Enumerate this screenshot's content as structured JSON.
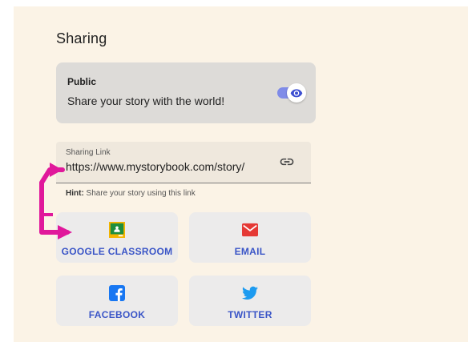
{
  "section": {
    "title": "Sharing"
  },
  "public": {
    "label": "Public",
    "description": "Share your story with the world!",
    "toggle_on": true
  },
  "sharing_link": {
    "label": "Sharing Link",
    "value": "https://www.mystorybook.com/story/",
    "hint_prefix": "Hint:",
    "hint_text": " Share your story using this link"
  },
  "share_buttons": [
    {
      "label": "GOOGLE CLASSROOM",
      "icon": "google-classroom-icon"
    },
    {
      "label": "EMAIL",
      "icon": "email-icon"
    },
    {
      "label": "FACEBOOK",
      "icon": "facebook-icon"
    },
    {
      "label": "TWITTER",
      "icon": "twitter-icon"
    }
  ],
  "colors": {
    "background": "#fbf3e6",
    "card": "#dddbd8",
    "toggle_accent": "#3d4fd1",
    "button_text": "#3a55c7",
    "annotation_arrow": "#e0189b"
  }
}
